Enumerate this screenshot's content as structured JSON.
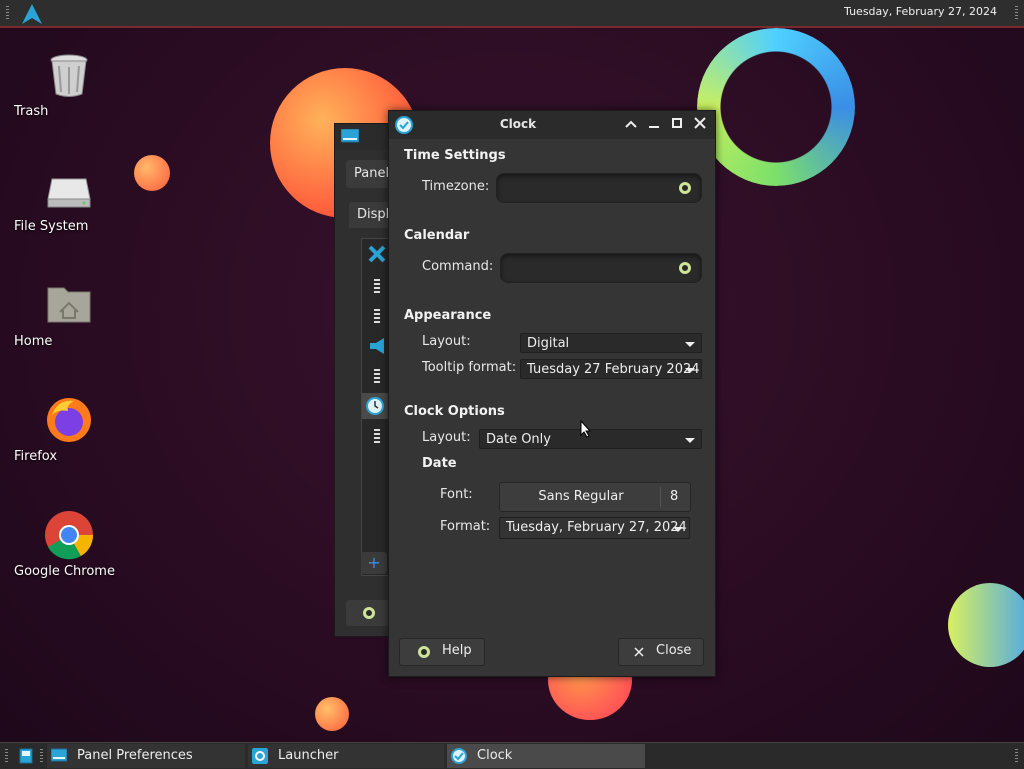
{
  "top_panel": {
    "clock": "Tuesday, February 27, 2024"
  },
  "desktop_icons": [
    {
      "label": "Trash"
    },
    {
      "label": "File System"
    },
    {
      "label": "Home"
    },
    {
      "label": "Firefox"
    },
    {
      "label": "Google Chrome"
    }
  ],
  "back_window": {
    "button_partial": "Panel",
    "tab_partial": "Displ"
  },
  "dialog": {
    "title": "Clock",
    "sections": {
      "time_settings": "Time Settings",
      "calendar": "Calendar",
      "appearance": "Appearance",
      "clock_options": "Clock Options",
      "date": "Date"
    },
    "timezone": {
      "label": "Timezone:",
      "value": ""
    },
    "command": {
      "label": "Command:",
      "value": ""
    },
    "appearance_layout": {
      "label": "Layout:",
      "value": "Digital"
    },
    "tooltip_format": {
      "label": "Tooltip format:",
      "value": "Tuesday 27 February 2024"
    },
    "clock_layout": {
      "label": "Layout:",
      "value": "Date Only"
    },
    "font": {
      "label": "Font:",
      "name": "Sans Regular",
      "size": "8"
    },
    "format": {
      "label": "Format:",
      "value": "Tuesday, February 27, 2024"
    },
    "help_label": "Help",
    "close_label": "Close"
  },
  "taskbar": {
    "tasks": [
      {
        "label": "Panel Preferences"
      },
      {
        "label": "Launcher"
      },
      {
        "label": "Clock"
      }
    ]
  },
  "colors": {
    "accent": "#2aa3d6",
    "panel_border": "#7a2a2a",
    "desktop_bg": "#2a0c22"
  }
}
